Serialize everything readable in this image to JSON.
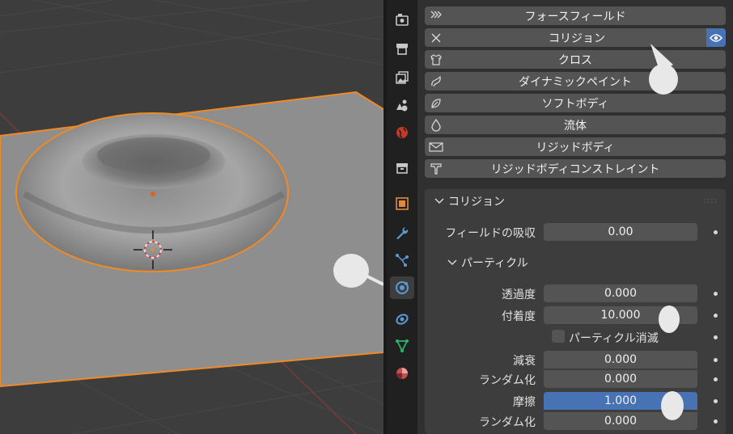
{
  "physics_buttons": [
    {
      "label": "フォースフィールド",
      "icon": "force-field-icon"
    },
    {
      "label": "コリジョン",
      "icon": "close-x-icon"
    },
    {
      "label": "クロス",
      "icon": "shirt-icon"
    },
    {
      "label": "ダイナミックペイント",
      "icon": "brush-icon"
    },
    {
      "label": "ソフトボディ",
      "icon": "soft-body-icon"
    },
    {
      "label": "流体",
      "icon": "droplet-icon"
    },
    {
      "label": "リジッドボディ",
      "icon": "rigid-body-icon"
    },
    {
      "label": "リジッドボディコンストレイント",
      "icon": "constraint-icon"
    }
  ],
  "collision_panel": {
    "title": "コリジョン",
    "field_absorption_label": "フィールドの吸収",
    "field_absorption_value": "0.00",
    "particle_section": "パーティクル",
    "permeability_label": "透過度",
    "permeability_value": "0.000",
    "stickiness_label": "付着度",
    "stickiness_value": "10.000",
    "kill_particles_label": "パーティクル消滅",
    "damping_label": "減衰",
    "damping_value": "0.000",
    "damping_random_label": "ランダム化",
    "damping_random_value": "0.000",
    "friction_label": "摩擦",
    "friction_value": "1.000",
    "friction_random_label": "ランダム化",
    "friction_random_value": "0.000"
  },
  "colors": {
    "accent": "#4772b3",
    "selection_outline": "#f08a24",
    "panel_bg": "#3d3d3d",
    "button_bg": "#545454"
  }
}
